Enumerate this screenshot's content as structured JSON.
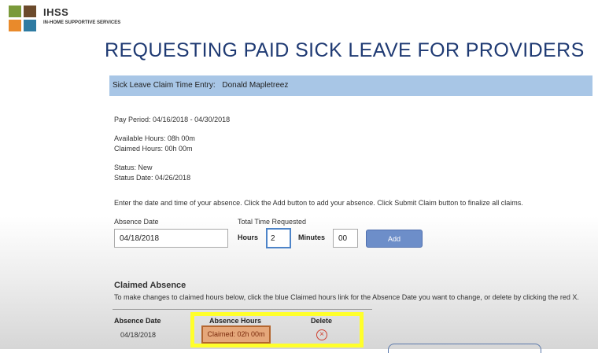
{
  "logo": {
    "brand": "IHSS",
    "brand_sub": "IN-HOME SUPPORTIVE SERVICES"
  },
  "page_title": "REQUESTING PAID SICK LEAVE FOR PROVIDERS",
  "header": {
    "label": "Sick Leave Claim Time Entry:",
    "provider_name": "Donald Mapletreez"
  },
  "info": {
    "pay_period": "Pay Period: 04/16/2018 - 04/30/2018",
    "available_hours": "Available Hours: 08h 00m",
    "claimed_hours": "Claimed Hours: 00h 00m",
    "status": "Status: New",
    "status_date": "Status Date: 04/26/2018"
  },
  "instructions": "Enter the date and time of your absence. Click the Add button to add your absence. Click Submit Claim button to finalize all claims.",
  "form": {
    "absence_date_label": "Absence Date",
    "absence_date_value": "04/18/2018",
    "total_time_label": "Total Time Requested",
    "hours_label": "Hours",
    "hours_value": "2",
    "minutes_label": "Minutes",
    "minutes_value": "00",
    "add_label": "Add"
  },
  "claimed_absence": {
    "title": "Claimed Absence",
    "instructions": "To make changes to claimed hours below, click the blue Claimed hours link for the Absence Date you want to change, or delete by clicking the red X.",
    "columns": [
      "Absence Date",
      "Absence Hours",
      "Delete"
    ],
    "rows": [
      {
        "absence_date": "04/18/2018",
        "absence_hours": "Claimed: 02h 00m"
      }
    ]
  },
  "colors": {
    "title": "#1f3a73",
    "header_bar": "#a8c6e6",
    "add_button": "#6d8ec9",
    "highlight": "#ffff2b",
    "delete": "#d04030"
  },
  "icons": {
    "delete": "close-circle-icon"
  }
}
